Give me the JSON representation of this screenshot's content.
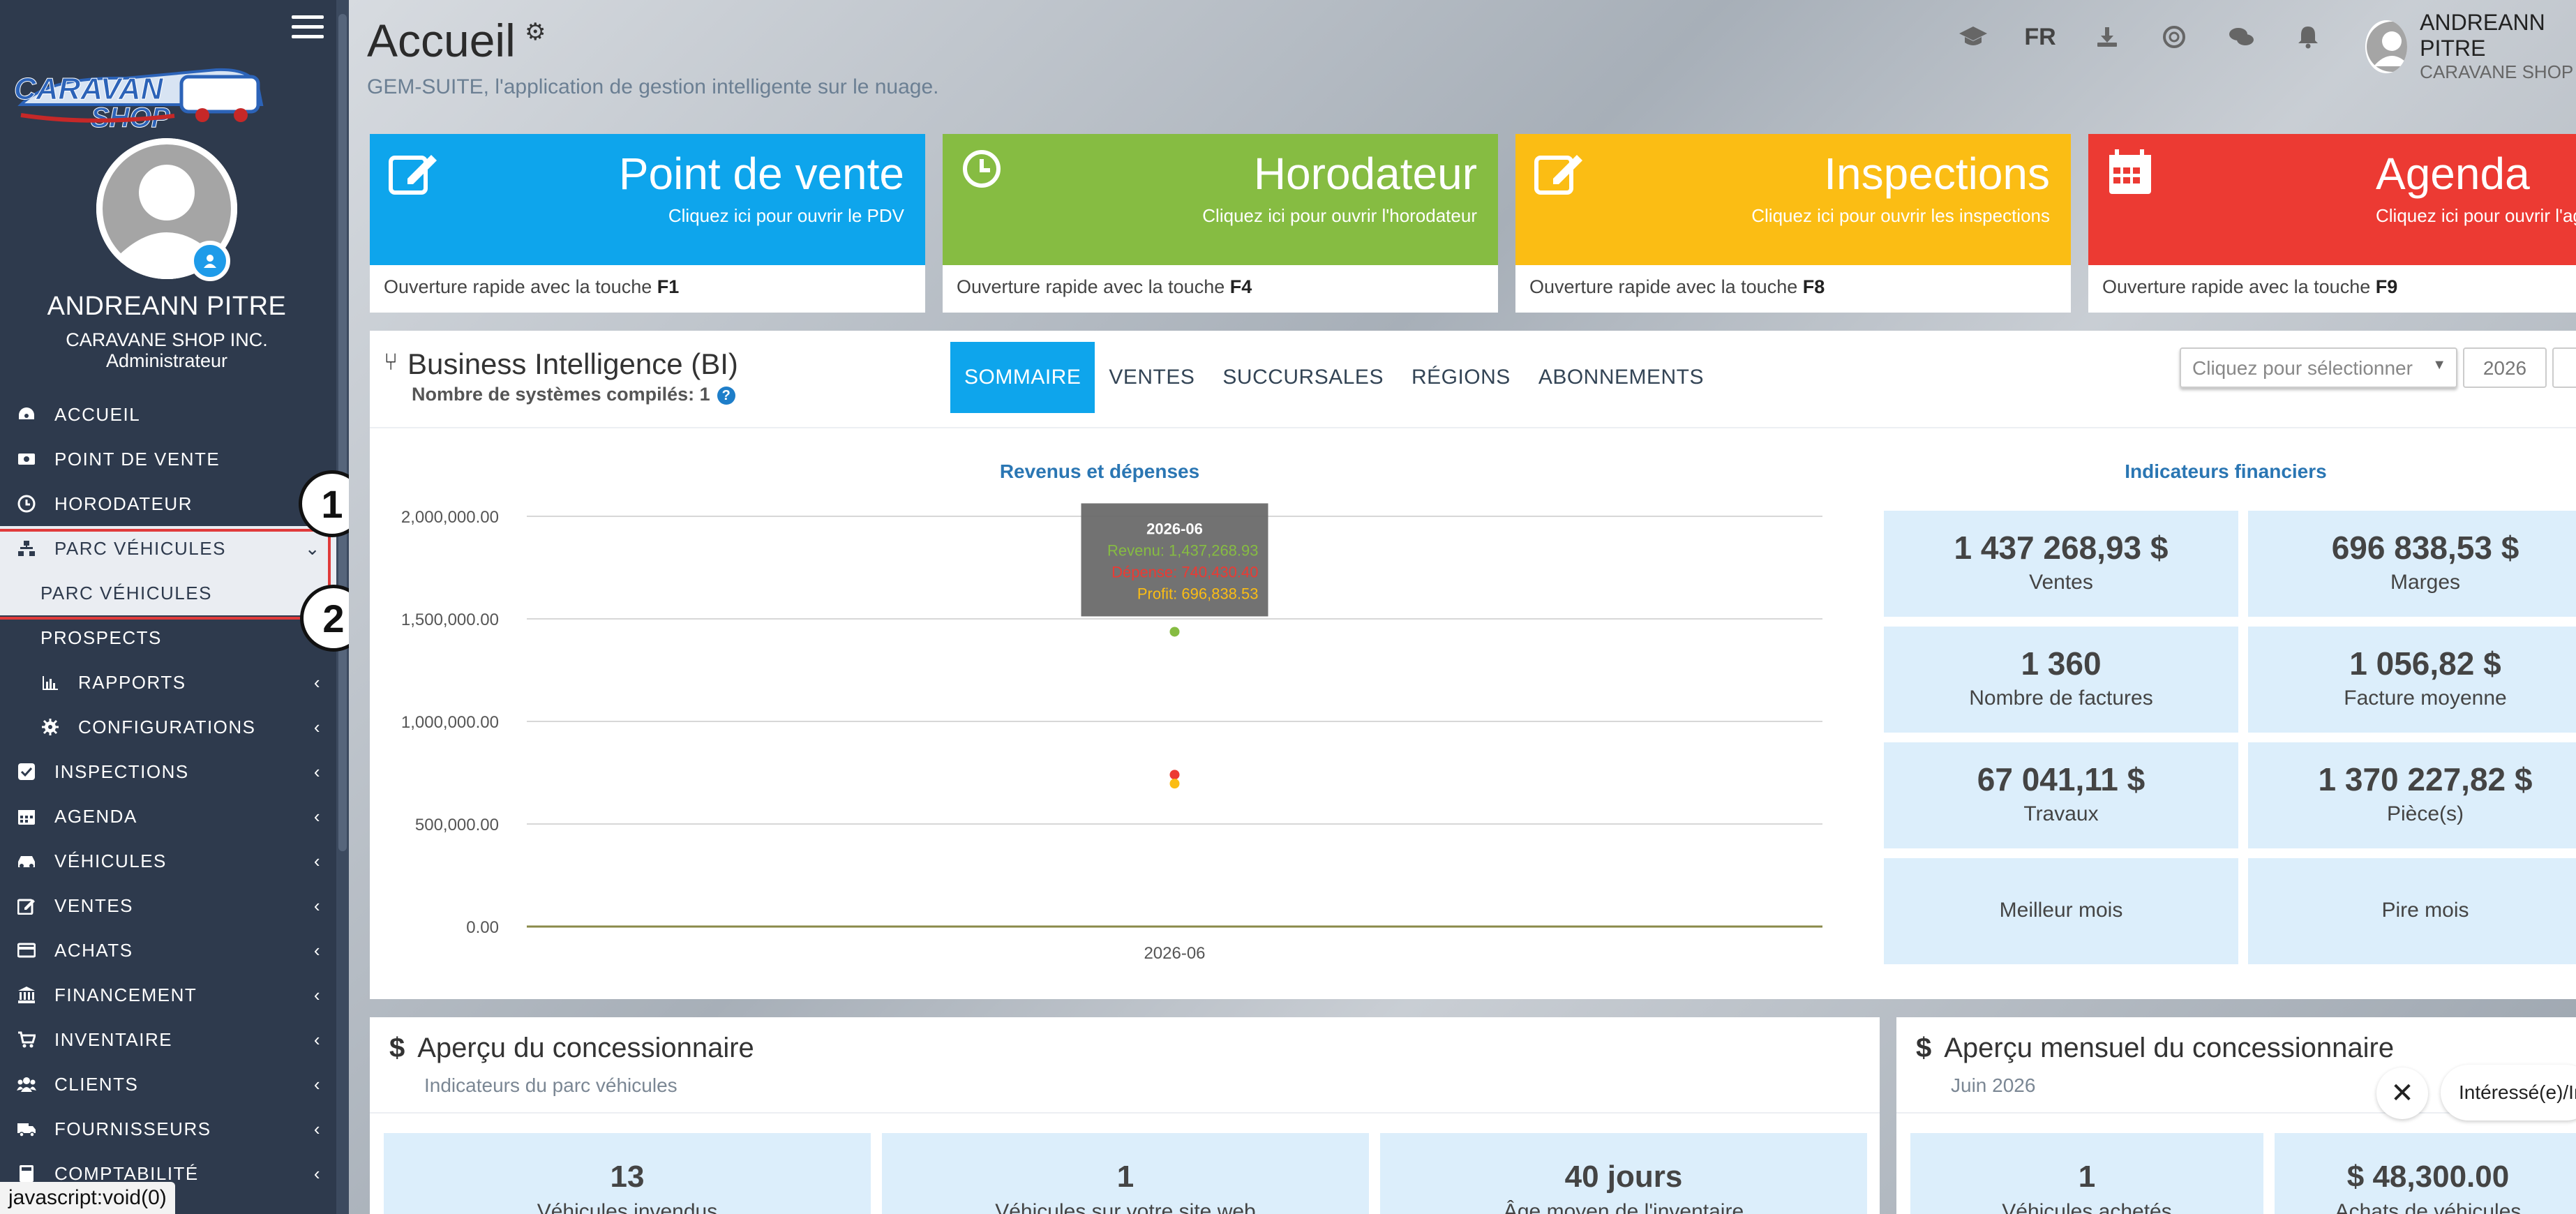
{
  "sidebar": {
    "logo_text": "CARAVANE SHOP",
    "user_name": "ANDREANN PITRE",
    "company": "CARAVANE SHOP INC.",
    "role": "Administrateur",
    "items": [
      {
        "label": "ACCUEIL",
        "icon": "dashboard-icon"
      },
      {
        "label": "POINT DE VENTE",
        "icon": "cash-icon"
      },
      {
        "label": "HORODATEUR",
        "icon": "clock-icon"
      },
      {
        "label": "PARC VÉHICULES",
        "icon": "sitemap-icon"
      },
      {
        "label": "PARC VÉHICULES"
      },
      {
        "label": "PROSPECTS"
      },
      {
        "label": "RAPPORTS",
        "icon": "bar-chart-icon"
      },
      {
        "label": "CONFIGURATIONS",
        "icon": "gear-icon"
      },
      {
        "label": "INSPECTIONS",
        "icon": "checkbox-icon"
      },
      {
        "label": "AGENDA",
        "icon": "calendar-icon"
      },
      {
        "label": "VÉHICULES",
        "icon": "car-icon"
      },
      {
        "label": "VENTES",
        "icon": "edit-icon"
      },
      {
        "label": "ACHATS",
        "icon": "credit-card-icon"
      },
      {
        "label": "FINANCEMENT",
        "icon": "bank-icon"
      },
      {
        "label": "INVENTAIRE",
        "icon": "cart-icon"
      },
      {
        "label": "CLIENTS",
        "icon": "users-icon"
      },
      {
        "label": "FOURNISSEURS",
        "icon": "truck-icon"
      },
      {
        "label": "COMPTABILITÉ",
        "icon": "calculator-icon"
      }
    ],
    "callouts": [
      "1",
      "2"
    ],
    "status_text": "javascript:void(0)"
  },
  "header": {
    "title": "Accueil",
    "subtitle": "GEM-SUITE, l'application de gestion intelligente sur le nuage.",
    "lang": "FR",
    "user_name": "ANDREANN PITRE",
    "user_company": "CARAVANE SHOP"
  },
  "tiles": [
    {
      "title": "Point de vente",
      "subtitle": "Cliquez ici pour ouvrir le PDV",
      "footer": "Ouverture rapide avec la touche",
      "key": "F1",
      "color": "#0ea5ec",
      "icon": "edit-icon"
    },
    {
      "title": "Horodateur",
      "subtitle": "Cliquez ici pour ouvrir l'horodateur",
      "footer": "Ouverture rapide avec la touche",
      "key": "F4",
      "color": "#86bc42",
      "icon": "clock-icon"
    },
    {
      "title": "Inspections",
      "subtitle": "Cliquez ici pour ouvrir les inspections",
      "footer": "Ouverture rapide avec la touche",
      "key": "F8",
      "color": "#fbbd14",
      "icon": "edit-icon"
    },
    {
      "title": "Agenda",
      "subtitle": "Cliquez ici pour ouvrir l'agenda",
      "footer": "Ouverture rapide avec la touche",
      "key": "F9",
      "color": "#ec3a33",
      "icon": "calendar-icon"
    }
  ],
  "bi": {
    "title": "Business Intelligence (BI)",
    "systems_label": "Nombre de systèmes compilés: 1",
    "tabs": [
      "SOMMAIRE",
      "VENTES",
      "SUCCURSALES",
      "RÉGIONS",
      "ABONNEMENTS"
    ],
    "select_placeholder": "Cliquez pour sélectionner",
    "year": "2026",
    "chart_title": "Revenus et dépenses",
    "fin_title": "Indicateurs financiers",
    "tooltip": {
      "title": "2026-06",
      "revenu": "Revenu: 1,437,268.93",
      "depense": "Dépense: 740,430.40",
      "profit": "Profit: 696,838.53"
    },
    "indicators": [
      {
        "value": "1 437 268,93 $",
        "label": "Ventes"
      },
      {
        "value": "696 838,53 $",
        "label": "Marges"
      },
      {
        "value": "1 360",
        "label": "Nombre de factures"
      },
      {
        "value": "1 056,82 $",
        "label": "Facture moyenne"
      },
      {
        "value": "67 041,11 $",
        "label": "Travaux"
      },
      {
        "value": "1 370 227,82 $",
        "label": "Pièce(s)"
      },
      {
        "value": "",
        "label": "Meilleur mois"
      },
      {
        "value": "",
        "label": "Pire mois"
      }
    ]
  },
  "chart_data": {
    "type": "scatter",
    "x": [
      "2026-06"
    ],
    "series": [
      {
        "name": "Revenu",
        "values": [
          1437268.93
        ],
        "color": "#86bc42"
      },
      {
        "name": "Dépense",
        "values": [
          740430.4
        ],
        "color": "#ec3a33"
      },
      {
        "name": "Profit",
        "values": [
          696838.53
        ],
        "color": "#fbbd14"
      }
    ],
    "yticks": [
      "2,000,000.00",
      "1,500,000.00",
      "1,000,000.00",
      "500,000.00",
      "0.00"
    ],
    "ylim": [
      0,
      2000000
    ],
    "title": "Revenus et dépenses",
    "xlabel": "",
    "ylabel": "",
    "grid": true
  },
  "dealer": {
    "title": "Aperçu du concessionnaire",
    "subtitle": "Indicateurs du parc véhicules",
    "stats": [
      {
        "value": "13",
        "label": "Véhicules invendus"
      },
      {
        "value": "1",
        "label": "Véhicules sur votre site web"
      },
      {
        "value": "40 jours",
        "label": "Âge moyen de l'inventaire"
      }
    ]
  },
  "monthly": {
    "title": "Aperçu mensuel du concessionnaire",
    "subtitle": "Juin 2026",
    "stats": [
      {
        "value": "1",
        "label": "Véhicules achetés"
      },
      {
        "value": "$ 48,300.00",
        "label": "Achats de véhicules"
      }
    ]
  },
  "toast": {
    "text": "Intéressé(e)/Interested?"
  }
}
